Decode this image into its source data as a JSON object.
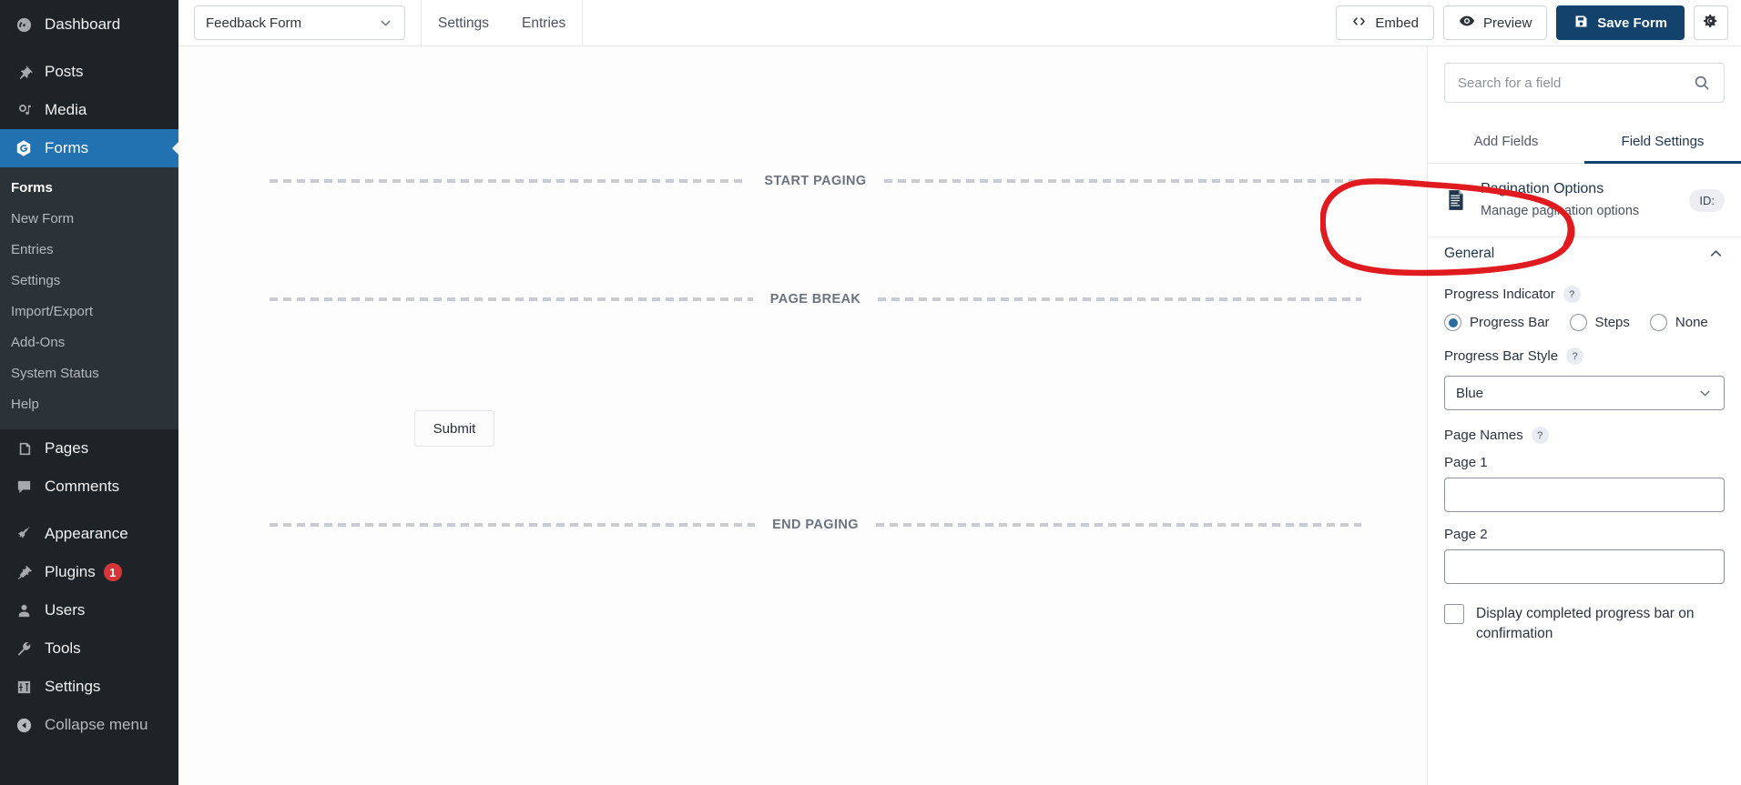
{
  "sidebar": {
    "items": [
      {
        "label": "Dashboard",
        "icon": "dashboard-icon"
      },
      {
        "label": "Posts",
        "icon": "pin-icon"
      },
      {
        "label": "Media",
        "icon": "media-icon"
      },
      {
        "label": "Forms",
        "icon": "forms-icon",
        "active": true
      },
      {
        "label": "Pages",
        "icon": "pages-icon"
      },
      {
        "label": "Comments",
        "icon": "comments-icon"
      },
      {
        "label": "Appearance",
        "icon": "brush-icon"
      },
      {
        "label": "Plugins",
        "icon": "plug-icon",
        "badge": "1"
      },
      {
        "label": "Users",
        "icon": "user-icon"
      },
      {
        "label": "Tools",
        "icon": "wrench-icon"
      },
      {
        "label": "Settings",
        "icon": "sliders-icon"
      }
    ],
    "submenu": [
      "Forms",
      "New Form",
      "Entries",
      "Settings",
      "Import/Export",
      "Add-Ons",
      "System Status",
      "Help"
    ],
    "collapse_label": "Collapse menu",
    "collapse_icon": "collapse-arrow-icon"
  },
  "toolbar": {
    "form_name": "Feedback Form",
    "form_select_icon": "chevron-down-icon",
    "tabs": [
      {
        "label": "Settings"
      },
      {
        "label": "Entries"
      }
    ],
    "embed_label": "Embed",
    "embed_icon": "code-icon",
    "preview_label": "Preview",
    "preview_icon": "eye-icon",
    "save_label": "Save Form",
    "save_icon": "floppy-disk-icon",
    "settings_icon": "gear-icon"
  },
  "canvas": {
    "start_paging_label": "START PAGING",
    "page_break_label": "PAGE BREAK",
    "end_paging_label": "END PAGING",
    "submit_label": "Submit"
  },
  "panel": {
    "search": {
      "placeholder": "Search for a field",
      "value": "",
      "icon": "search-icon"
    },
    "tabs": [
      {
        "label": "Add Fields",
        "active": false
      },
      {
        "label": "Field Settings",
        "active": true
      }
    ],
    "field": {
      "icon": "document-icon",
      "title": "Pagination Options",
      "subtitle": "Manage pagination options",
      "id_badge": "ID:"
    },
    "section": {
      "title": "General",
      "collapse_icon": "chevron-up-icon"
    },
    "progress_indicator": {
      "label": "Progress Indicator",
      "help_icon": "help-icon",
      "help_glyph": "?",
      "options": [
        {
          "label": "Progress Bar",
          "selected": true
        },
        {
          "label": "Steps",
          "selected": false
        },
        {
          "label": "None",
          "selected": false
        }
      ]
    },
    "progress_bar_style": {
      "label": "Progress Bar Style",
      "help_glyph": "?",
      "value": "Blue",
      "icon": "chevron-down-icon"
    },
    "page_names": {
      "label": "Page Names",
      "help_glyph": "?",
      "fields": [
        {
          "label": "Page 1",
          "value": ""
        },
        {
          "label": "Page 2",
          "value": ""
        }
      ]
    },
    "confirmation_checkbox": {
      "label": "Display completed progress bar on confirmation",
      "checked": false
    }
  },
  "annotation": {
    "shape": "red-ellipse-highlight",
    "color": "#e01b20"
  },
  "colors": {
    "sidebar_bg": "#1d2327",
    "sidebar_submenu_bg": "#2c3338",
    "accent_blue": "#2271b1",
    "save_navy": "#13436c",
    "badge_red": "#d63638",
    "annotation_red": "#e01b20"
  }
}
